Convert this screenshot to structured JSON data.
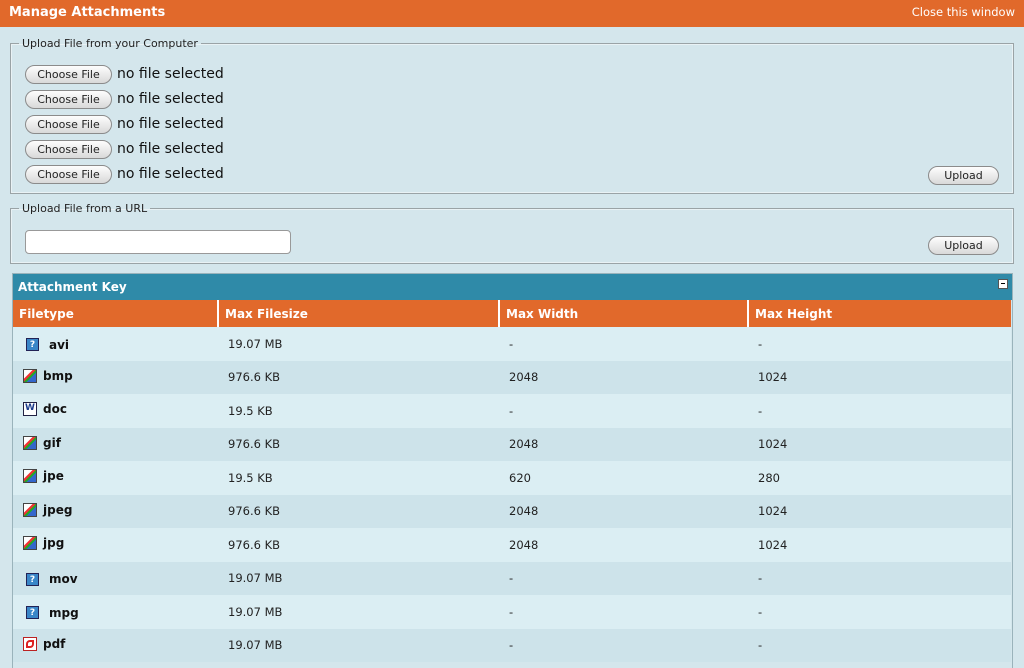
{
  "header": {
    "title": "Manage Attachments",
    "close_label": "Close this window"
  },
  "computer_upload": {
    "legend": "Upload File from your Computer",
    "rows": [
      {
        "button": "Choose File",
        "status": "no file selected"
      },
      {
        "button": "Choose File",
        "status": "no file selected"
      },
      {
        "button": "Choose File",
        "status": "no file selected"
      },
      {
        "button": "Choose File",
        "status": "no file selected"
      },
      {
        "button": "Choose File",
        "status": "no file selected"
      }
    ],
    "upload_label": "Upload"
  },
  "url_upload": {
    "legend": "Upload File from a URL",
    "url_value": "",
    "upload_label": "Upload"
  },
  "attachment_key": {
    "title": "Attachment Key",
    "columns": [
      "Filetype",
      "Max Filesize",
      "Max Width",
      "Max Height"
    ],
    "rows": [
      {
        "icon": "unknown-file-icon",
        "type": "avi",
        "size": "19.07 MB",
        "width": "-",
        "height": "-"
      },
      {
        "icon": "image-file-icon",
        "type": "bmp",
        "size": "976.6 KB",
        "width": "2048",
        "height": "1024"
      },
      {
        "icon": "word-doc-icon",
        "type": "doc",
        "size": "19.5 KB",
        "width": "-",
        "height": "-"
      },
      {
        "icon": "image-file-icon",
        "type": "gif",
        "size": "976.6 KB",
        "width": "2048",
        "height": "1024"
      },
      {
        "icon": "image-file-icon",
        "type": "jpe",
        "size": "19.5 KB",
        "width": "620",
        "height": "280"
      },
      {
        "icon": "image-file-icon",
        "type": "jpeg",
        "size": "976.6 KB",
        "width": "2048",
        "height": "1024"
      },
      {
        "icon": "image-file-icon",
        "type": "jpg",
        "size": "976.6 KB",
        "width": "2048",
        "height": "1024"
      },
      {
        "icon": "unknown-file-icon",
        "type": "mov",
        "size": "19.07 MB",
        "width": "-",
        "height": "-"
      },
      {
        "icon": "unknown-file-icon",
        "type": "mpg",
        "size": "19.07 MB",
        "width": "-",
        "height": "-"
      },
      {
        "icon": "pdf-file-icon",
        "type": "pdf",
        "size": "19.07 MB",
        "width": "-",
        "height": "-"
      }
    ]
  },
  "colors": {
    "header": "#e1692b",
    "key_header": "#2f8aa8",
    "background": "#d4e6ec"
  }
}
